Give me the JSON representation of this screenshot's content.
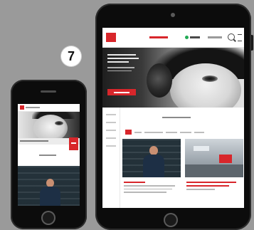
{
  "step_badge": {
    "number": "7"
  },
  "colors": {
    "accent": "#d8262b",
    "background": "#9a9a9a",
    "device": "#0c0c0c"
  },
  "icons": {
    "tablet_search": "search-icon",
    "tablet_menu": "menu-icon"
  }
}
